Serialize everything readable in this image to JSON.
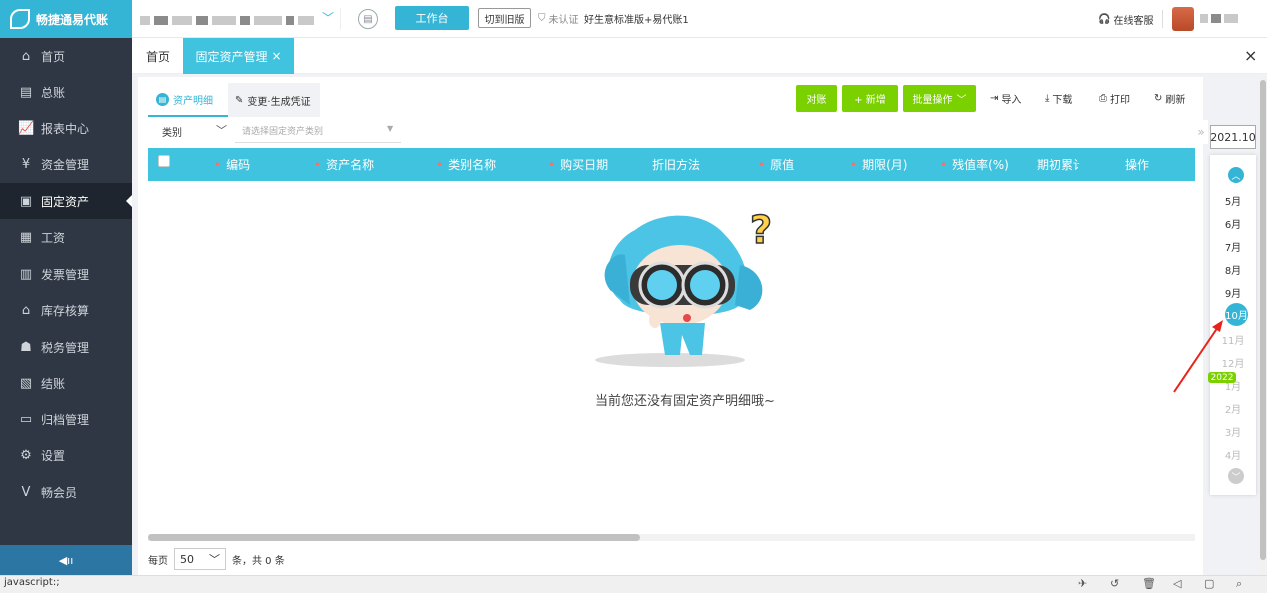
{
  "app": {
    "logo_text": "畅捷通易代账"
  },
  "header": {
    "workbench_label": "工作台",
    "old_version_label": "切到旧版",
    "cert_status": "未认证",
    "edition": "好生意标准版+易代账1",
    "service_label": "在线客服"
  },
  "sidebar": {
    "items": [
      {
        "label": "首页",
        "icon": "home-icon",
        "glyph": "⌂"
      },
      {
        "label": "总账",
        "icon": "ledger-icon",
        "glyph": "▤"
      },
      {
        "label": "报表中心",
        "icon": "chart-icon",
        "glyph": "📈"
      },
      {
        "label": "资金管理",
        "icon": "money-icon",
        "glyph": "¥"
      },
      {
        "label": "固定资产",
        "icon": "asset-icon",
        "glyph": "▣"
      },
      {
        "label": "工资",
        "icon": "salary-icon",
        "glyph": "▦"
      },
      {
        "label": "发票管理",
        "icon": "invoice-icon",
        "glyph": "▥"
      },
      {
        "label": "库存核算",
        "icon": "warehouse-icon",
        "glyph": "⌂"
      },
      {
        "label": "税务管理",
        "icon": "tax-icon",
        "glyph": "☗"
      },
      {
        "label": "结账",
        "icon": "checkout-icon",
        "glyph": "▧"
      },
      {
        "label": "归档管理",
        "icon": "archive-icon",
        "glyph": "▭"
      },
      {
        "label": "设置",
        "icon": "gear-icon",
        "glyph": "⚙"
      },
      {
        "label": "畅会员",
        "icon": "vip-icon",
        "glyph": "V"
      }
    ],
    "active_index": 4,
    "collapse_glyph": "◀ıı"
  },
  "tabs": {
    "home": "首页",
    "asset": "固定资产管理",
    "close": "×"
  },
  "subtabs": {
    "detail": "资产明细",
    "change": "变更·生成凭证"
  },
  "toolbar": {
    "reconcile": "对账",
    "add": "+ 新增",
    "batch": "批量操作",
    "import": "导入",
    "download": "下载",
    "print": "打印",
    "refresh": "刷新"
  },
  "filter": {
    "label": "类别",
    "placeholder": "请选择固定资产类别"
  },
  "table": {
    "columns": [
      {
        "label": "编码",
        "required": true
      },
      {
        "label": "资产名称",
        "required": true
      },
      {
        "label": "类别名称",
        "required": true
      },
      {
        "label": "购买日期",
        "required": true
      },
      {
        "label": "折旧方法",
        "required": false
      },
      {
        "label": "原值",
        "required": true
      },
      {
        "label": "期限(月)",
        "required": true
      },
      {
        "label": "残值率(%)",
        "required": true
      },
      {
        "label": "期初累计",
        "required": false
      },
      {
        "label": "操作",
        "required": false
      }
    ],
    "empty_text": "当前您还没有固定资产明细哦~"
  },
  "pager": {
    "per_page_label": "每页",
    "page_size": "50",
    "total_text": "条，共 0 条"
  },
  "periods": {
    "current": "2021.10",
    "months": [
      {
        "label": "5月",
        "state": "normal"
      },
      {
        "label": "6月",
        "state": "normal"
      },
      {
        "label": "7月",
        "state": "normal"
      },
      {
        "label": "8月",
        "state": "normal"
      },
      {
        "label": "9月",
        "state": "normal"
      },
      {
        "label": "10月",
        "state": "active"
      },
      {
        "label": "11月",
        "state": "dim"
      },
      {
        "label": "12月",
        "state": "dim"
      },
      {
        "label": "1月",
        "state": "dim"
      },
      {
        "label": "2月",
        "state": "dim"
      },
      {
        "label": "3月",
        "state": "dim"
      },
      {
        "label": "4月",
        "state": "dim"
      }
    ],
    "year_badge": "2022"
  },
  "status": {
    "url": "javascript:;"
  },
  "colors": {
    "accent": "#35b5d6",
    "green": "#7bd000",
    "sidebar": "#2f3744",
    "table_header": "#40c3df"
  }
}
